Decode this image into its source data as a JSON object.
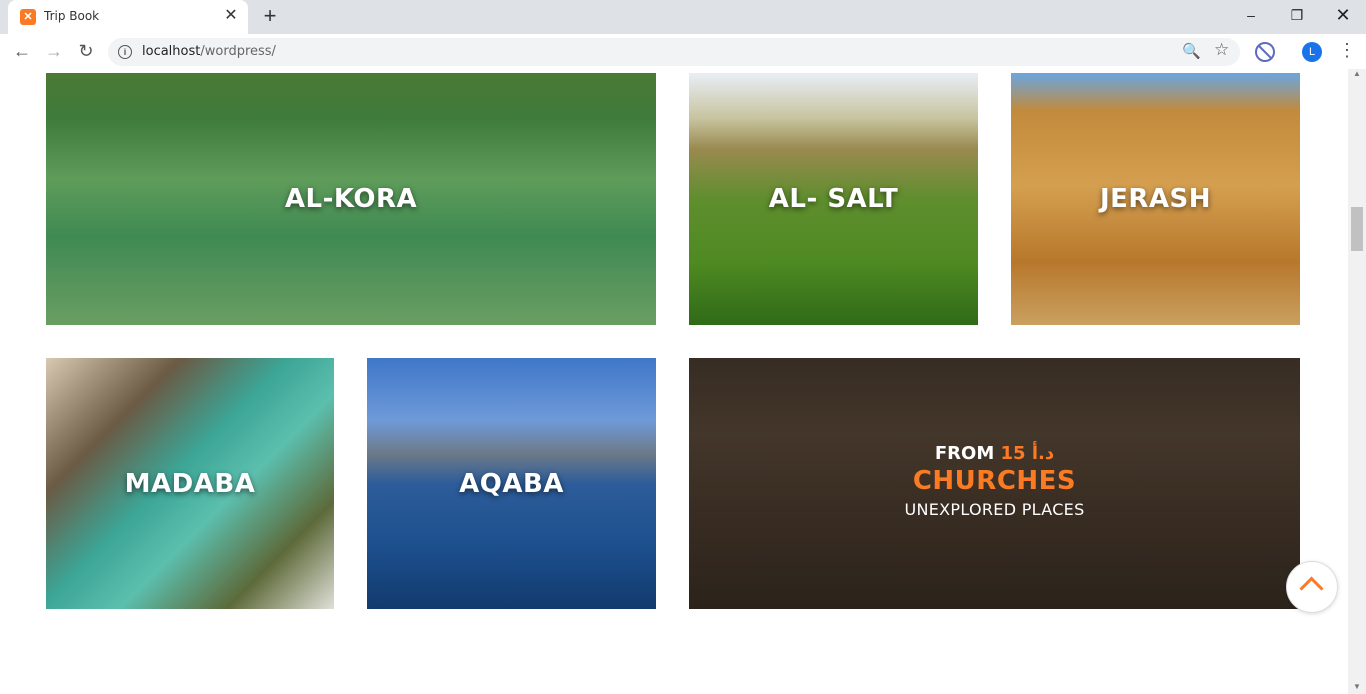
{
  "browser": {
    "tab_title": "Trip Book",
    "tab_close": "✕",
    "new_tab": "+",
    "window_minimize": "–",
    "window_restore": "❐",
    "window_close": "✕",
    "url_host": "localhost",
    "url_path": "/wordpress/",
    "avatar_letter": "L",
    "back": "←",
    "forward": "→",
    "reload": "↻",
    "zoom": "🔍",
    "star": "☆",
    "menu": "⋮"
  },
  "destinations": [
    {
      "name": "AL-KORA"
    },
    {
      "name": "AL- SALT"
    },
    {
      "name": "JERASH"
    },
    {
      "name": "MADABA"
    },
    {
      "name": "AQABA"
    }
  ],
  "promo": {
    "from_label": "FROM",
    "price": "15 د.أ",
    "title": "CHURCHES",
    "subtitle": "UNEXPLORED PLACES"
  },
  "colors": {
    "accent": "#fb7a24"
  },
  "icons": {
    "scroll_top": "chevron-up-icon"
  }
}
